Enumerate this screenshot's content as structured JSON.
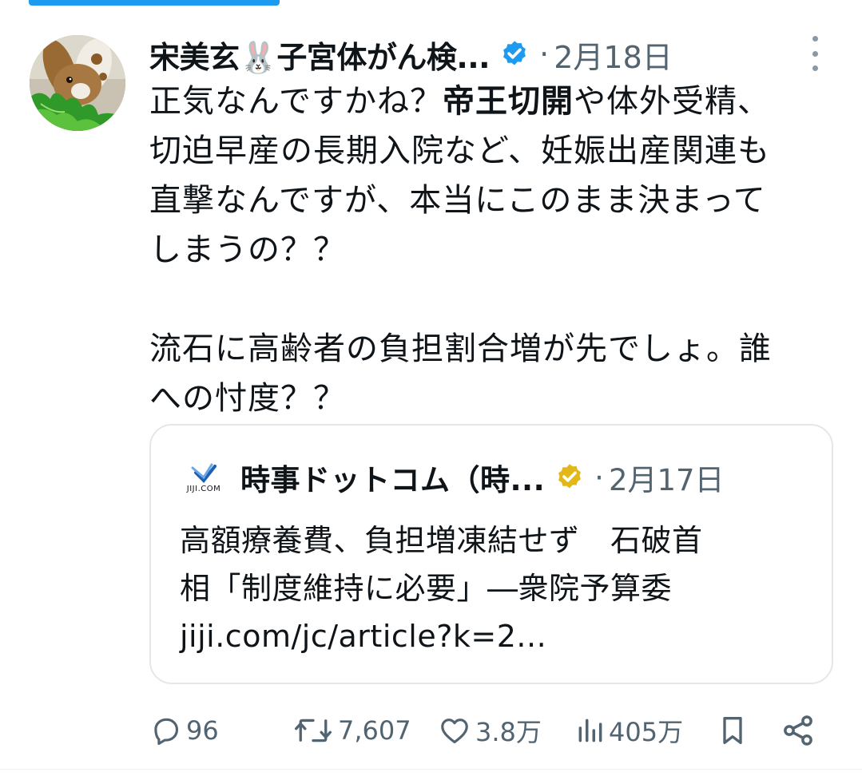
{
  "progress": {
    "fraction": 0.29,
    "color": "#1d9bf0"
  },
  "post": {
    "author_name": "宋美玄🐰子宮体がん検...",
    "verified_badge_icon": "verified-blue-check-icon",
    "separator": "·",
    "date": "2月18日",
    "more_icon": "more-vertical-icon",
    "body_line1_before": "正気なんですかね？",
    "body_line1_bold": "帝王切開",
    "body_line1_after": "や体外受精、",
    "body_line2": "切迫早産の長期入院など、妊娠出産関連も",
    "body_line3": "直撃なんですが、本当にこのまま決まって",
    "body_line4": "しまうの？？",
    "body_line5": "流石に高齢者の負担割合増が先でしょ。誰",
    "body_line6": "への忖度？？"
  },
  "quote": {
    "logo_text": "JIJI.COM",
    "author_name": "時事ドットコム（時...",
    "badge_icon": "verified-gold-check-icon",
    "separator": "·",
    "date": "2月17日",
    "text_line1": "高額療養費、負担増凍結せず　石破首",
    "text_line2": "相「制度維持に必要」―衆院予算委",
    "link": "jiji.com/jc/article?k=2..."
  },
  "actions": {
    "reply": {
      "icon": "reply-icon",
      "count": "96"
    },
    "repost": {
      "icon": "repost-icon",
      "count": "7,607"
    },
    "like": {
      "icon": "heart-icon",
      "count": "3.8万"
    },
    "views": {
      "icon": "views-chart-icon",
      "count": "405万"
    },
    "bookmark": {
      "icon": "bookmark-icon"
    },
    "share": {
      "icon": "share-icon"
    }
  },
  "colors": {
    "text": "#0f1419",
    "secondary": "#536471",
    "accent_blue": "#1d9bf0",
    "gold_badge": "#e2b719",
    "border": "#e3e7ea"
  }
}
